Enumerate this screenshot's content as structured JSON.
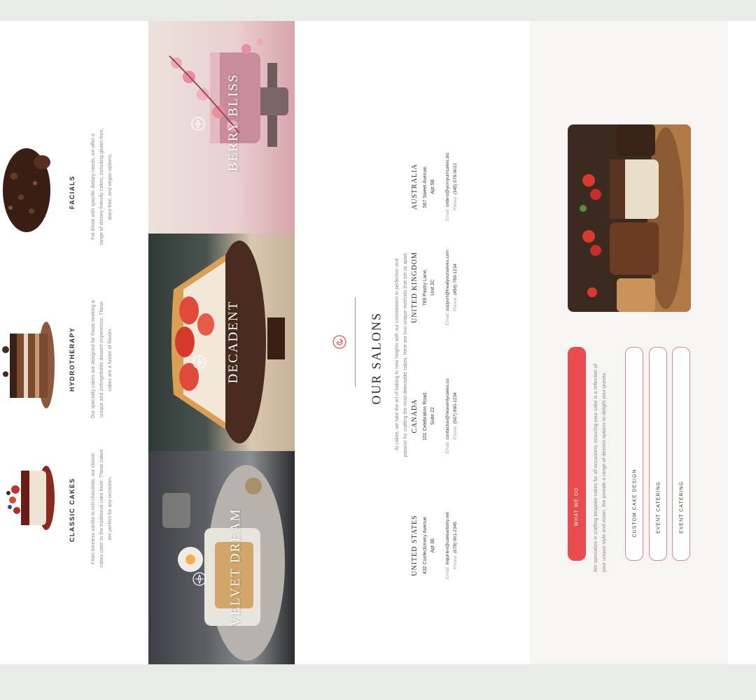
{
  "services": [
    {
      "title": "CLASSIC CAKES",
      "description": "From timeless vanilla to rich chocolate, our classic cakes cater to the traditional cake lover. These cakes are perfect for any occasion."
    },
    {
      "title": "HYDROTHERAPY",
      "description": "Our specialty cakes are designed for those seeking a unique and unforgettable dessert experience. These cakes are a fusion of flavors."
    },
    {
      "title": "FACIALS",
      "description": "For those with specific dietary needs, we offer a range of dietary-friendly cakes, including gluten-free, dairy-free, and vegan options."
    }
  ],
  "panels": [
    {
      "label": "VELVET DREAM"
    },
    {
      "label": "DECADENT"
    },
    {
      "label": "BERRY BLISS"
    }
  ],
  "salons": {
    "heading": "OUR SALONS",
    "intro": "At cakes, we take the art of baking to new heights with our commitment to perfection and passion for crafting the most delectable cakes. Here are four unique methods that set us apart.",
    "email_label": "Email:",
    "phone_label": "Phone:",
    "locations": [
      {
        "country": "UNITED STATES",
        "address_line1": "432 Confectionery Avenue",
        "address_line2": "Apt 3E",
        "email": "inquiries@cakeartistry.net",
        "phone": "(678) 901-2345"
      },
      {
        "country": "CANADA",
        "address_line1": "101 Celebration Road,",
        "address_line2": "Suite 22",
        "email": "contactus@heavenlycakes.co",
        "phone": "(567) 890-1234"
      },
      {
        "country": "UNITED KINGDOM",
        "address_line1": "789 Pastry Lane,",
        "address_line2": "Unit 3C",
        "email": "support@treatyourselves.com",
        "phone": "(456) 789-1234"
      },
      {
        "country": "AUSTRALIA",
        "address_line1": "567 Sweet Avenue,",
        "address_line2": "Apt 5B",
        "email": "orders@yumyumcakes.biz",
        "phone": "(345) 678-9012"
      }
    ]
  },
  "what_we_do": {
    "tab_label": "WHAT WE DO",
    "description": "We specialize in crafting bespoke cakes for all occasions, ensuring your cake is a reflection of your unique style and vision. We provide a range of dessert options to delight your guests.",
    "items": [
      {
        "label": "CUSTOM CAKE DESIGN"
      },
      {
        "label": "EVENT CATERING"
      },
      {
        "label": "EVENT CATERING"
      }
    ]
  },
  "colors": {
    "accent": "#e84c4f",
    "pill_border": "#d98a8a",
    "text_dark": "#2c2a28",
    "text_muted": "#8d8a87"
  },
  "icons": {
    "salons_emblem": "swirl-icon",
    "panel_emblem": "leaf-emblem-icon"
  }
}
